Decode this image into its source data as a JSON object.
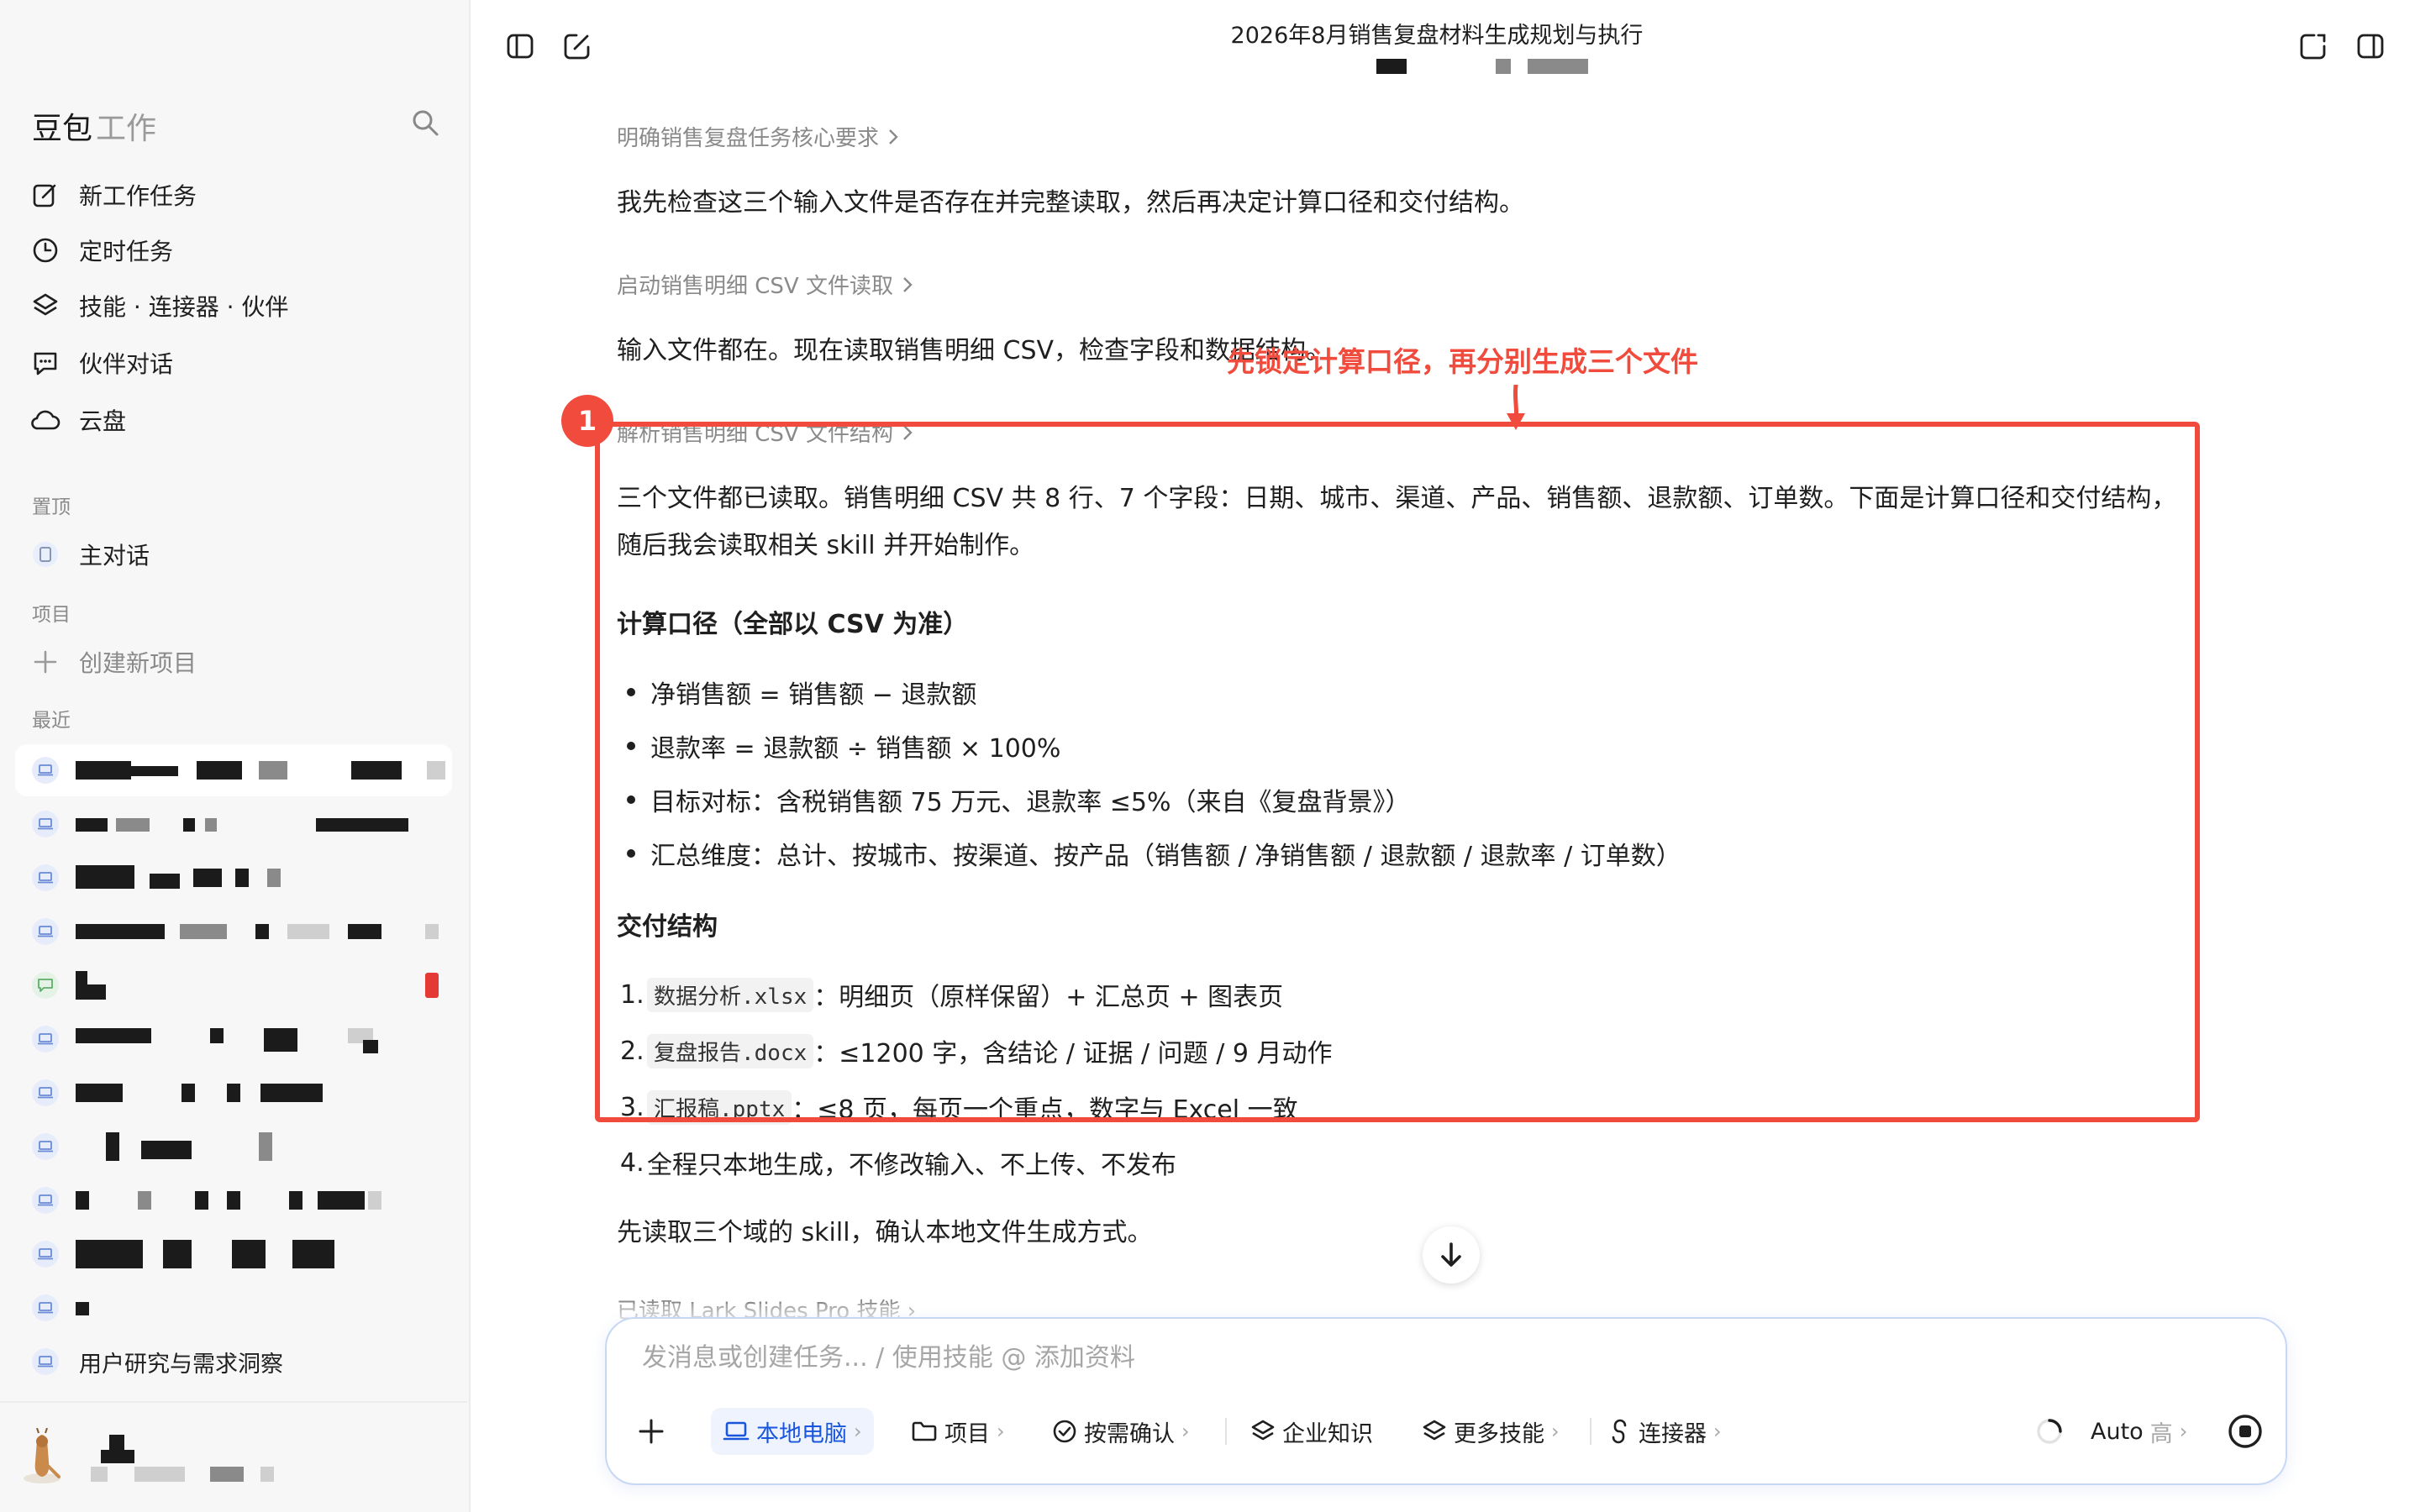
{
  "app": {
    "brand_primary": "豆包",
    "brand_secondary": "工作",
    "title": "2026年8月销售复盘材料生成规划与执行"
  },
  "sidebar": {
    "nav": [
      {
        "label": "新工作任务",
        "icon": "edit-icon"
      },
      {
        "label": "定时任务",
        "icon": "clock-icon"
      },
      {
        "label": "技能 · 连接器 · 伙伴",
        "icon": "layers-icon"
      },
      {
        "label": "伙伴对话",
        "icon": "chat-icon"
      },
      {
        "label": "云盘",
        "icon": "cloud-icon"
      }
    ],
    "pinned_label": "置顶",
    "pinned_item": "主对话",
    "projects_label": "项目",
    "create_project": "创建新项目",
    "recent_label": "最近",
    "recent_last": "用户研究与需求洞察"
  },
  "content": {
    "step1": "明确销售复盘任务核心要求",
    "para1": "我先检查这三个输入文件是否存在并完整读取，然后再决定计算口径和交付结构。",
    "step2": "启动销售明细 CSV 文件读取",
    "para2": "输入文件都在。现在读取销售明细 CSV，检查字段和数据结构。",
    "step3": "解析销售明细 CSV 文件结构",
    "para3_line1": "三个文件都已读取。销售明细 CSV 共 8 行、7 个字段：日期、城市、渠道、产品、销售额、退款额、订单数。下面是计算口径和交付结构，",
    "para3_line2": "随后我会读取相关 skill 并开始制作。",
    "heading_calc": "计算口径（全部以 CSV 为准）",
    "bullets": [
      "净销售额 = 销售额 − 退款额",
      "退款率 = 退款额 ÷ 销售额 × 100%",
      "目标对标：含税销售额 75 万元、退款率 ≤5%（来自《复盘背景》）",
      "汇总维度：总计、按城市、按渠道、按产品（销售额 / 净销售额 / 退款额 / 退款率 / 订单数）"
    ],
    "heading_deliver": "交付结构",
    "deliverables": [
      {
        "num": "1.",
        "code": "数据分析.xlsx",
        "text": "：明细页（原样保留）+ 汇总页 + 图表页"
      },
      {
        "num": "2.",
        "code": "复盘报告.docx",
        "text": "：≤1200 字，含结论 / 证据 / 问题 / 9 月动作"
      },
      {
        "num": "3.",
        "code": "汇报稿.pptx",
        "text": "：≤8 页，每页一个重点，数字与 Excel 一致"
      },
      {
        "num": "4.",
        "code": "",
        "text": "全程只本地生成，不修改输入、不上传、不发布"
      }
    ],
    "para4": "先读取三个域的 skill，确认本地文件生成方式。",
    "step_last": "已读取 Lark Slides Pro 技能"
  },
  "annotation": {
    "badge": "1",
    "text": "先锁定计算口径，再分别生成三个文件",
    "color": "#f04b3c"
  },
  "composer": {
    "placeholder": "发消息或创建任务... / 使用技能 @ 添加资料",
    "tools": {
      "local": "本地电脑",
      "project": "项目",
      "confirm": "按需确认",
      "knowledge": "企业知识",
      "skills": "更多技能",
      "connector": "连接器"
    },
    "model": "Auto",
    "model_level": "高"
  },
  "colors": {
    "accent": "#1a56db",
    "annotation": "#f04b3c",
    "sidebar_bg": "#f7f7f7"
  }
}
